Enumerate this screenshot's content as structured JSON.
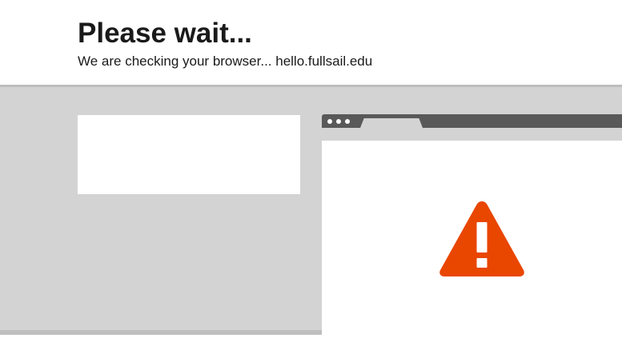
{
  "header": {
    "title": "Please wait...",
    "subtitle": "We are checking your browser... hello.fullsail.edu"
  },
  "illustration": {
    "warning_icon": "warning-triangle-icon",
    "warning_color": "#e94600",
    "band_color": "#d3d3d3",
    "browser_bar_color": "#595959"
  }
}
